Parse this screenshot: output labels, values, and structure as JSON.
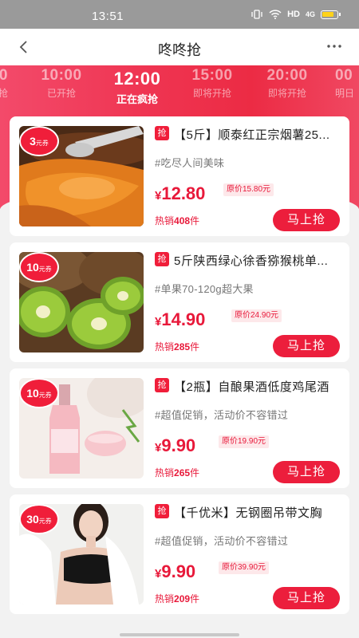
{
  "status": {
    "time": "13:51",
    "network": "HD",
    "signal": "4G"
  },
  "header": {
    "title": "咚咚抢",
    "back_icon": "chevron-left-icon",
    "more_icon": "more-dots-icon"
  },
  "timeslots": [
    {
      "time": "0",
      "status": "抢"
    },
    {
      "time": "10:00",
      "status": "已开抢"
    },
    {
      "time": "12:00",
      "status": "正在疯抢"
    },
    {
      "time": "15:00",
      "status": "即将开抢"
    },
    {
      "time": "20:00",
      "status": "即将开抢"
    },
    {
      "time": "00",
      "status": "明日"
    }
  ],
  "products": [
    {
      "coupon": "3",
      "coupon_unit": "元券",
      "tag": "抢",
      "name": "【5斤】顺泰红正宗烟薯25...",
      "desc": "#吃尽人间美味",
      "currency": "¥",
      "price": "12.80",
      "original": "原价15.80元",
      "sold_label": "热销",
      "sold": "408",
      "sold_unit": "件",
      "buy": "马上抢"
    },
    {
      "coupon": "10",
      "coupon_unit": "元券",
      "tag": "抢",
      "name": "5斤陕西绿心徐香猕猴桃单...",
      "desc": "#单果70-120g超大果",
      "currency": "¥",
      "price": "14.90",
      "original": "原价24.90元",
      "sold_label": "热销",
      "sold": "285",
      "sold_unit": "件",
      "buy": "马上抢"
    },
    {
      "coupon": "10",
      "coupon_unit": "元券",
      "tag": "抢",
      "name": "【2瓶】自酿果酒低度鸡尾酒",
      "desc": "#超值促销，活动价不容错过",
      "currency": "¥",
      "price": "9.90",
      "original": "原价19.90元",
      "sold_label": "热销",
      "sold": "265",
      "sold_unit": "件",
      "buy": "马上抢"
    },
    {
      "coupon": "30",
      "coupon_unit": "元券",
      "tag": "抢",
      "name": "【千优米】无钢圈吊带文胸",
      "desc": "#超值促销，活动价不容错过",
      "currency": "¥",
      "price": "9.90",
      "original": "原价39.90元",
      "sold_label": "热销",
      "sold": "209",
      "sold_unit": "件",
      "buy": "马上抢"
    }
  ],
  "colors": {
    "accent": "#ec1e3c",
    "band": "#ef3552"
  }
}
